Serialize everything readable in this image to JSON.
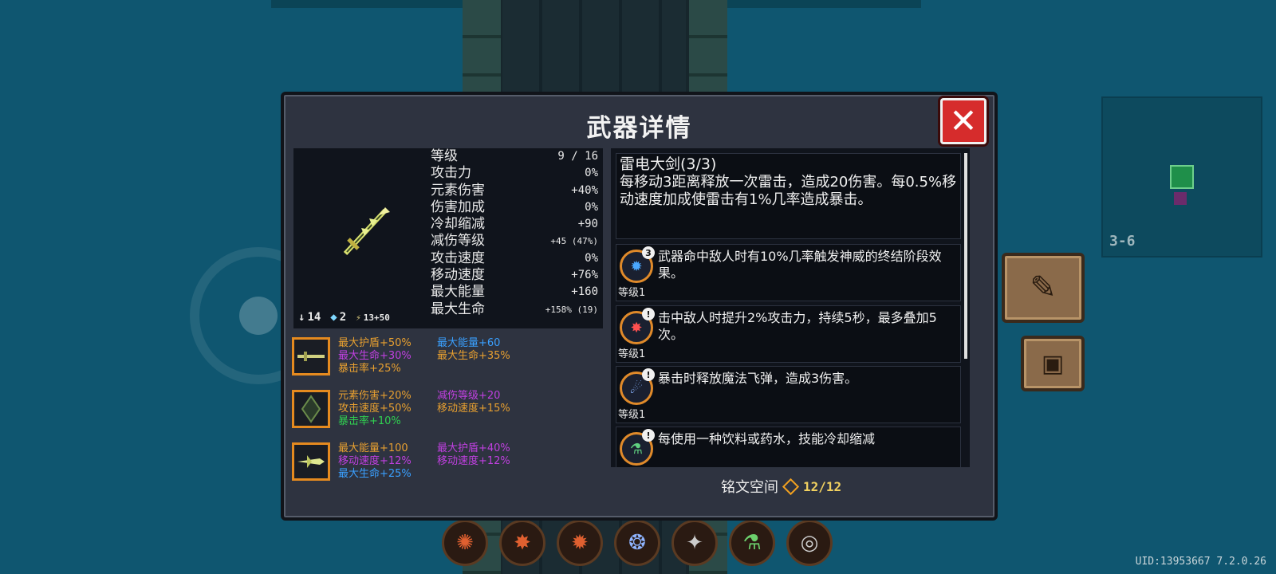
{
  "panel": {
    "title": "武器详情",
    "close_icon": "close-icon"
  },
  "weapon": {
    "stats": [
      {
        "label": "等级",
        "value": "9 / 16"
      },
      {
        "label": "攻击力",
        "value": "0%"
      },
      {
        "label": "元素伤害",
        "value": "+40%"
      },
      {
        "label": "伤害加成",
        "value": "0%"
      },
      {
        "label": "冷却缩减",
        "value": "+90"
      },
      {
        "label": "减伤等级",
        "value": "+45 (47%)"
      },
      {
        "label": "攻击速度",
        "value": "0%"
      },
      {
        "label": "移动速度",
        "value": "+76%"
      },
      {
        "label": "最大能量",
        "value": "+160"
      },
      {
        "label": "最大生命",
        "value": "+158% (19)"
      }
    ],
    "mini": {
      "dmg": "14",
      "gem": "2",
      "energy": "13+50"
    }
  },
  "equips": [
    {
      "attrs": [
        {
          "text": "最大护盾+50%",
          "color": "orange"
        },
        {
          "text": "最大能量+60",
          "color": "blue"
        },
        {
          "text": "最大生命+30%",
          "color": "purple"
        },
        {
          "text": "最大生命+35%",
          "color": "orange"
        },
        {
          "text": "暴击率+25%",
          "color": "orange"
        },
        {
          "text": "",
          "color": "orange"
        }
      ]
    },
    {
      "attrs": [
        {
          "text": "元素伤害+20%",
          "color": "orange"
        },
        {
          "text": "减伤等级+20",
          "color": "purple"
        },
        {
          "text": "攻击速度+50%",
          "color": "orange"
        },
        {
          "text": "移动速度+15%",
          "color": "orange"
        },
        {
          "text": "暴击率+10%",
          "color": "green"
        },
        {
          "text": "",
          "color": "green"
        }
      ]
    },
    {
      "attrs": [
        {
          "text": "最大能量+100",
          "color": "orange"
        },
        {
          "text": "最大护盾+40%",
          "color": "purple"
        },
        {
          "text": "移动速度+12%",
          "color": "purple"
        },
        {
          "text": "移动速度+12%",
          "color": "purple"
        },
        {
          "text": "最大生命+25%",
          "color": "blue"
        },
        {
          "text": "",
          "color": "blue"
        }
      ]
    }
  ],
  "description": {
    "name": "雷电大剑(3/3)",
    "text": "每移动3距离释放一次雷击，造成20伤害。每0.5%移动速度加成使雷击有1%几率造成暴击。"
  },
  "runes": [
    {
      "badge": "3",
      "text": "武器命中敌人时有10%几率触发神威的终结阶段效果。",
      "level": "等级1",
      "icon": "rune-blue-flame-icon"
    },
    {
      "badge": "!",
      "text": "击中敌人时提升2%攻击力，持续5秒，最多叠加5次。",
      "level": "等级1",
      "icon": "rune-red-spark-icon"
    },
    {
      "badge": "!",
      "text": "暴击时释放魔法飞弹，造成3伤害。",
      "level": "等级1",
      "icon": "rune-missile-icon"
    },
    {
      "badge": "!",
      "text": "每使用一种饮料或药水，技能冷却缩减",
      "level": "",
      "icon": "rune-potion-icon"
    }
  ],
  "inscription": {
    "label": "铭文空间",
    "count": "12/12"
  },
  "minimap": {
    "level": "3-6"
  },
  "uid": "UID:13953667 7.2.0.26",
  "colors": {
    "orange": "#e8a030",
    "blue": "#3aa0ff",
    "purple": "#c040e0",
    "green": "#30d050"
  }
}
